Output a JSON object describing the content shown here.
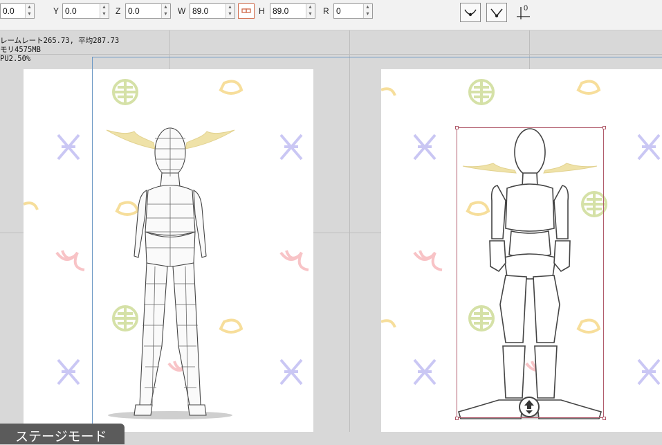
{
  "toolbar": {
    "x": {
      "label": "",
      "value": "0.0"
    },
    "y": {
      "label": "Y",
      "value": "0.0"
    },
    "z": {
      "label": "Z",
      "value": "0.0"
    },
    "w": {
      "label": "W",
      "value": "89.0"
    },
    "h": {
      "label": "H",
      "value": "89.0"
    },
    "r": {
      "label": "R",
      "value": "0"
    },
    "link_icon": "link-aspect-icon",
    "tools": [
      "curve-down-icon",
      "vertex-v-icon",
      "axis-origin-icon"
    ],
    "axis_label": "0"
  },
  "stats": {
    "line1": "レームレート265.73, 平均287.73",
    "line2": "モリ4575MB",
    "line3": "PU2.50%"
  },
  "mode_tab": {
    "label": "ステージモード"
  },
  "colors": {
    "selection_frame": "#6a97c4",
    "bounding_box": "#b05a6a",
    "antler": "#efe2a8",
    "pattern_green": "#c8d88a",
    "pattern_yellow": "#f4d37a",
    "pattern_blue": "#b8b4f0",
    "pattern_pink": "#f6b0b4"
  }
}
